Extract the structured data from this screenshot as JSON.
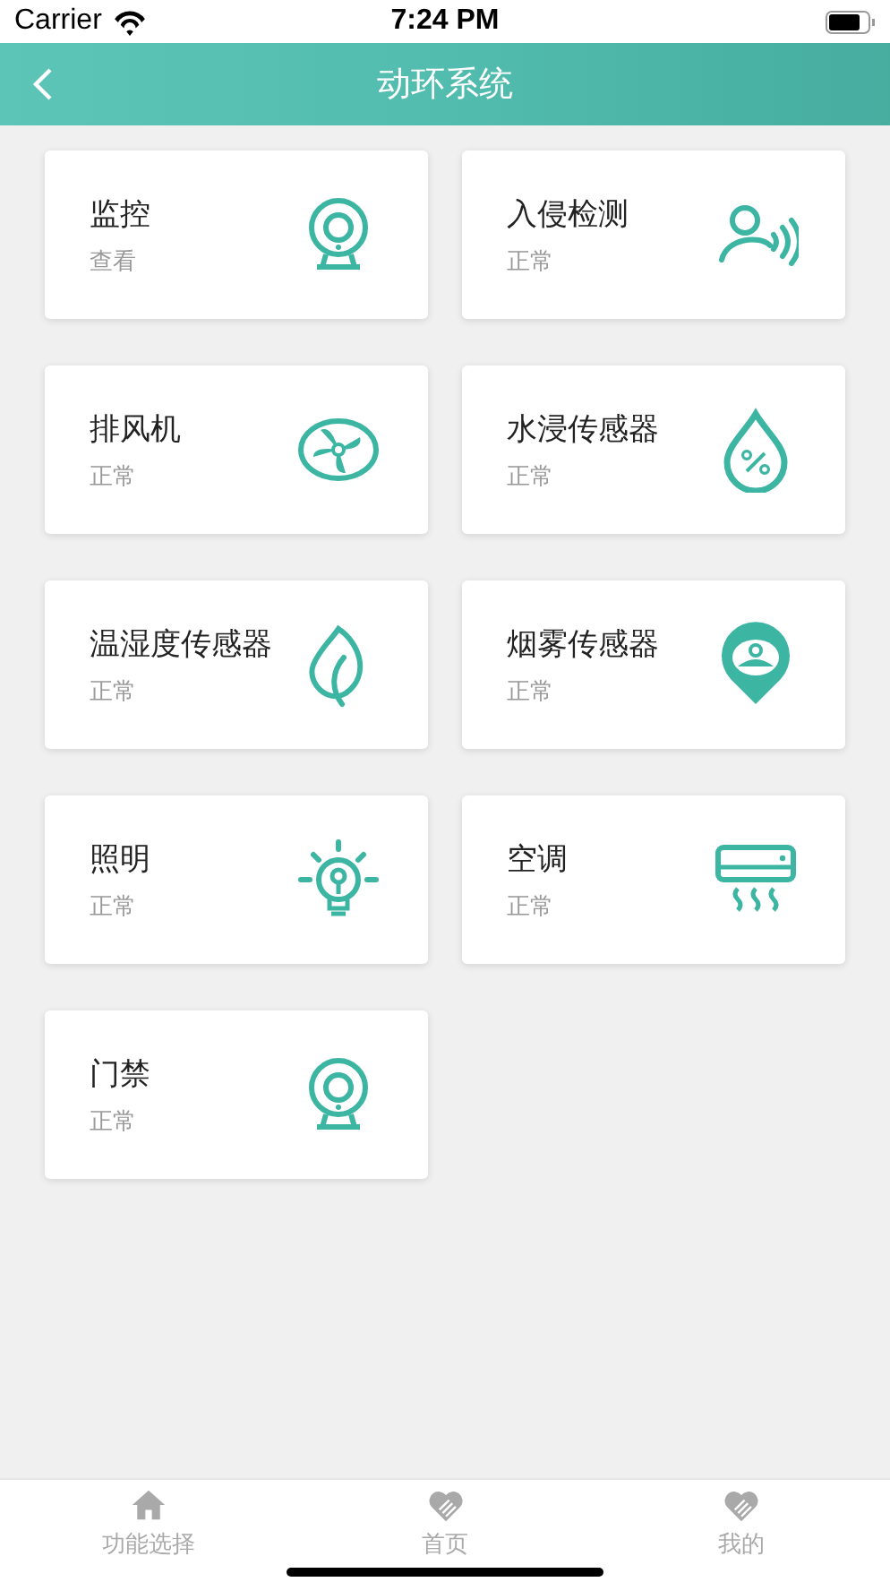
{
  "status_bar": {
    "carrier": "Carrier",
    "time": "7:24 PM"
  },
  "nav": {
    "title": "动环系统"
  },
  "cards": [
    {
      "title": "监控",
      "status": "查看",
      "kind": "camera"
    },
    {
      "title": "入侵检测",
      "status": "正常",
      "kind": "person"
    },
    {
      "title": "排风机",
      "status": "正常",
      "kind": "fan"
    },
    {
      "title": "水浸传感器",
      "status": "正常",
      "kind": "drop"
    },
    {
      "title": "温湿度传感器",
      "status": "正常",
      "kind": "leaf"
    },
    {
      "title": "烟雾传感器",
      "status": "正常",
      "kind": "pin"
    },
    {
      "title": "照明",
      "status": "正常",
      "kind": "bulb"
    },
    {
      "title": "空调",
      "status": "正常",
      "kind": "ac"
    },
    {
      "title": "门禁",
      "status": "正常",
      "kind": "camera"
    }
  ],
  "tab_bar": [
    {
      "label": "功能选择",
      "kind": "home"
    },
    {
      "label": "首页",
      "kind": "heart"
    },
    {
      "label": "我的",
      "kind": "heart"
    }
  ]
}
